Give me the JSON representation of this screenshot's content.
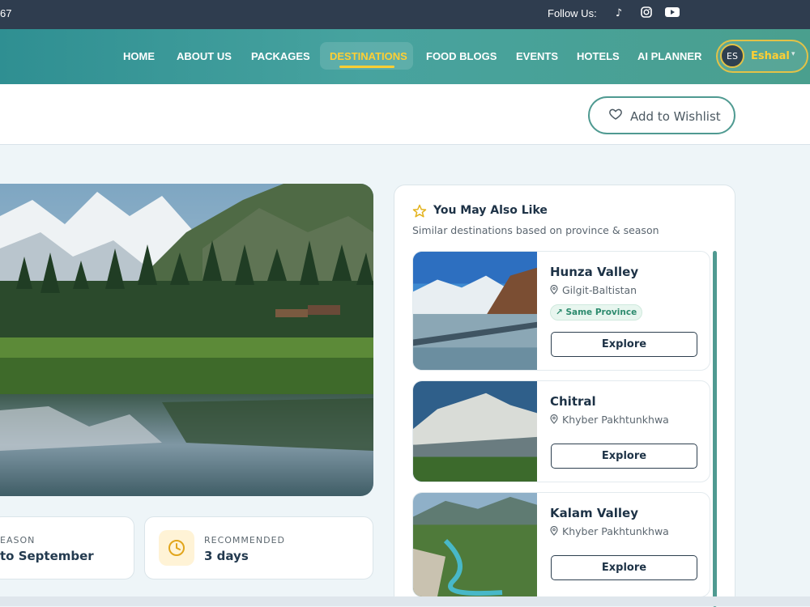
{
  "topbar": {
    "phone": "67",
    "follow_label": "Follow Us:",
    "icons": [
      "tiktok-icon",
      "instagram-icon",
      "youtube-icon"
    ]
  },
  "nav": {
    "items": [
      "HOME",
      "ABOUT US",
      "PACKAGES",
      "DESTINATIONS",
      "FOOD BLOGS",
      "EVENTS",
      "HOTELS",
      "AI PLANNER"
    ],
    "active": "DESTINATIONS",
    "user_initials": "ES",
    "user_name": "Eshaal"
  },
  "actions": {
    "wishlist": "Add to Wishlist"
  },
  "info": {
    "season_label": "EASON",
    "season_value": "to September",
    "recommended_label": "RECOMMENDED",
    "recommended_value": "3 days"
  },
  "sidebar": {
    "title": "You May Also Like",
    "subtitle": "Similar destinations based on province & season",
    "items": [
      {
        "name": "Hunza Valley",
        "province": "Gilgit-Baltistan",
        "badge": "Same Province",
        "button": "Explore"
      },
      {
        "name": "Chitral",
        "province": "Khyber Pakhtunkhwa",
        "button": "Explore"
      },
      {
        "name": "Kalam Valley",
        "province": "Khyber Pakhtunkhwa",
        "button": "Explore"
      }
    ]
  },
  "colors": {
    "accent": "#4f9a91",
    "gold": "#ffcf33",
    "dark": "#2f3d4f"
  }
}
